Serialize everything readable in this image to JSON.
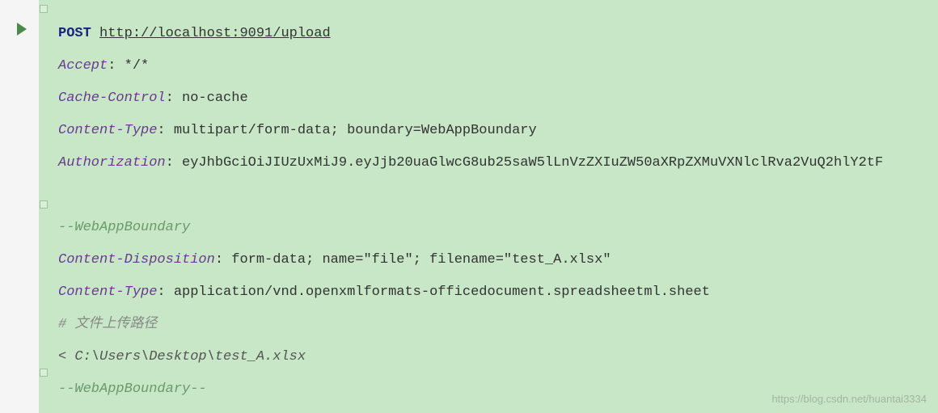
{
  "request": {
    "method": "POST",
    "url": "http://localhost:9091/upload",
    "headers": [
      {
        "name": "Accept",
        "value": "*/*"
      },
      {
        "name": "Cache-Control",
        "value": "no-cache"
      },
      {
        "name": "Content-Type",
        "value": "multipart/form-data; boundary=WebAppBoundary"
      },
      {
        "name": "Authorization",
        "value": "eyJhbGciOiJIUzUxMiJ9.eyJjb20uaGlwcG8ub25saW5lLnVzZXIuZW50aXRpZXMuVXNlclRva2VuQ2hlY2tF"
      }
    ],
    "boundary_open": "--WebAppBoundary",
    "part_headers": [
      {
        "name": "Content-Disposition",
        "value": "form-data; name=\"file\"; filename=\"test_A.xlsx\""
      },
      {
        "name": "Content-Type",
        "value": "application/vnd.openxmlformats-officedocument.spreadsheetml.sheet"
      }
    ],
    "comment": "# 文件上传路径",
    "input_line_prefix": "< ",
    "input_line_path": "C:\\Users\\Desktop\\test_A.xlsx",
    "boundary_close": "--WebAppBoundary--"
  },
  "watermark": "https://blog.csdn.net/huantai3334"
}
